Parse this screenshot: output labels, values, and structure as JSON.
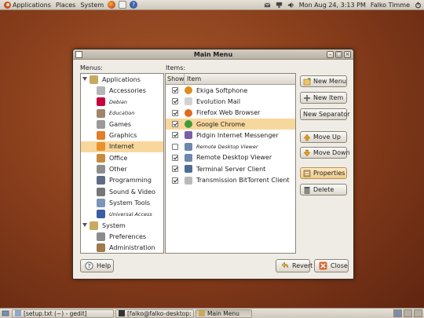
{
  "top_panel": {
    "applications": "Applications",
    "places": "Places",
    "system": "System",
    "clock": "Mon Aug 24,  3:13 PM",
    "user": "Falko Timme"
  },
  "window": {
    "title": "Main Menu",
    "menus_label": "Menus:",
    "items_label": "Items:"
  },
  "menus_tree": [
    {
      "label": "Applications",
      "level": 0,
      "expanded": true,
      "icon": "applications-icon"
    },
    {
      "label": "Accessories",
      "level": 1,
      "icon": "accessories-icon"
    },
    {
      "label": "Debian",
      "level": 1,
      "italic": true,
      "icon": "debian-icon"
    },
    {
      "label": "Education",
      "level": 1,
      "italic": true,
      "icon": "education-icon"
    },
    {
      "label": "Games",
      "level": 1,
      "icon": "games-icon"
    },
    {
      "label": "Graphics",
      "level": 1,
      "icon": "graphics-icon"
    },
    {
      "label": "Internet",
      "level": 1,
      "selected": true,
      "icon": "internet-icon"
    },
    {
      "label": "Office",
      "level": 1,
      "icon": "office-icon"
    },
    {
      "label": "Other",
      "level": 1,
      "icon": "other-icon"
    },
    {
      "label": "Programming",
      "level": 1,
      "icon": "programming-icon"
    },
    {
      "label": "Sound & Video",
      "level": 1,
      "icon": "sound-video-icon"
    },
    {
      "label": "System Tools",
      "level": 1,
      "icon": "system-tools-icon"
    },
    {
      "label": "Universal Access",
      "level": 1,
      "italic": true,
      "icon": "universal-access-icon"
    },
    {
      "label": "System",
      "level": 0,
      "expanded": true,
      "icon": "system-icon"
    },
    {
      "label": "Preferences",
      "level": 1,
      "icon": "preferences-icon"
    },
    {
      "label": "Administration",
      "level": 1,
      "icon": "administration-icon"
    }
  ],
  "items_list": {
    "col_show": "Show",
    "col_item": "Item",
    "rows": [
      {
        "label": "Ekiga Softphone",
        "checked": true,
        "icon": "ekiga-icon"
      },
      {
        "label": "Evolution Mail",
        "checked": true,
        "icon": "evolution-icon"
      },
      {
        "label": "Firefox Web Browser",
        "checked": true,
        "icon": "firefox-icon"
      },
      {
        "label": "Google Chrome",
        "checked": true,
        "selected": true,
        "icon": "chrome-icon"
      },
      {
        "label": "Pidgin Internet Messenger",
        "checked": true,
        "icon": "pidgin-icon"
      },
      {
        "label": "Remote Desktop Viewer",
        "checked": false,
        "italic": true,
        "icon": "remote-desktop-icon"
      },
      {
        "label": "Remote Desktop Viewer",
        "checked": true,
        "icon": "remote-desktop-icon"
      },
      {
        "label": "Terminal Server Client",
        "checked": true,
        "icon": "terminal-server-icon"
      },
      {
        "label": "Transmission BitTorrent Client",
        "checked": true,
        "icon": "transmission-icon"
      }
    ]
  },
  "buttons": {
    "new_menu": "New Menu",
    "new_item": "New Item",
    "new_separator": "New Separator",
    "move_up": "Move Up",
    "move_down": "Move Down",
    "properties": "Properties",
    "delete": "Delete",
    "help": "Help",
    "revert": "Revert",
    "close": "Close"
  },
  "taskbar": {
    "tasks": [
      {
        "label": "[setup.txt (~) - gedit]",
        "active": false
      },
      {
        "label": "[falko@falko-desktop: ...",
        "active": false
      },
      {
        "label": "Main Menu",
        "active": true
      }
    ]
  },
  "colors": {
    "selection": "#f8d79d",
    "desktop": "#8a3f1c"
  }
}
